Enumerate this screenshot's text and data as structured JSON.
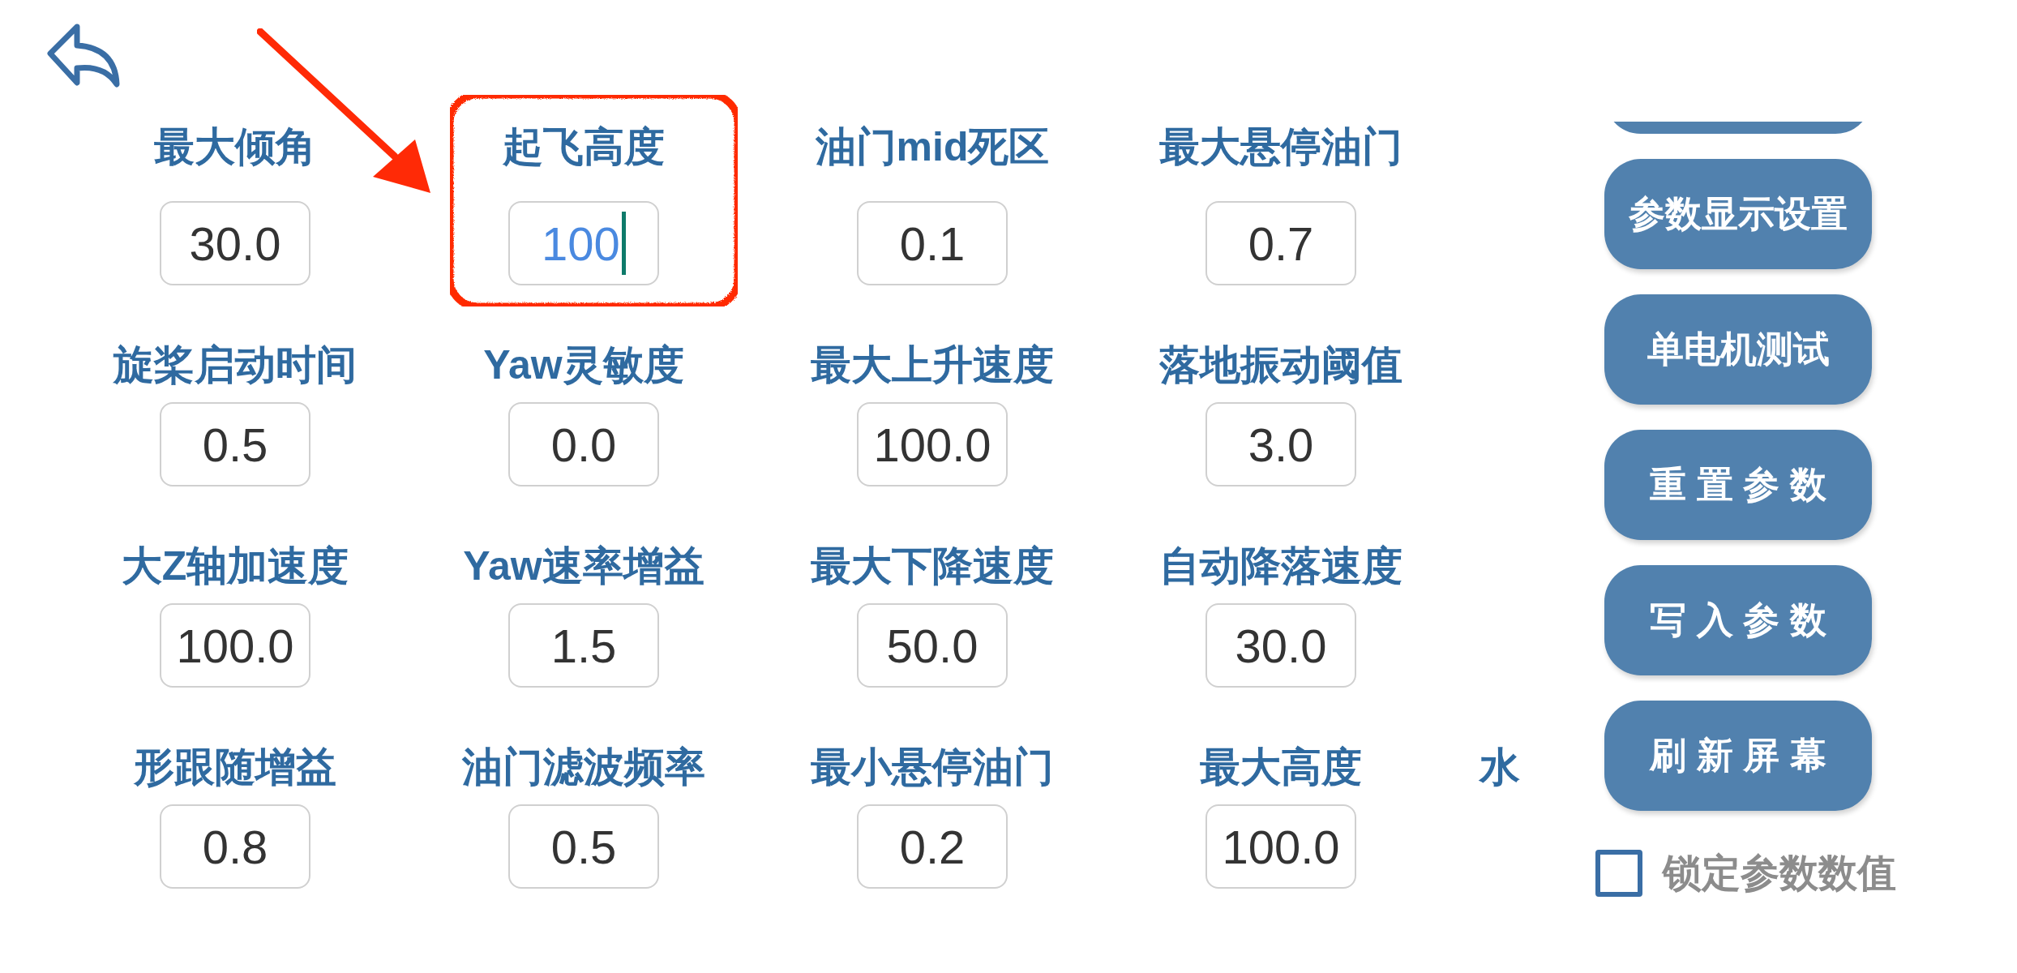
{
  "parameter_grid": {
    "rows": [
      {
        "cells": [
          {
            "label": "最大倾角",
            "value": "30.0",
            "focused": false,
            "highlighted": false
          },
          {
            "label": "起飞高度",
            "value": "100",
            "focused": true,
            "highlighted": true
          },
          {
            "label": "油门mid死区",
            "value": "0.1",
            "focused": false,
            "highlighted": false
          },
          {
            "label": "最大悬停油门",
            "value": "0.7",
            "focused": false,
            "highlighted": false
          }
        ]
      },
      {
        "cells": [
          {
            "label": "旋桨启动时间",
            "value": "0.5",
            "focused": false,
            "highlighted": false
          },
          {
            "label": "Yaw灵敏度",
            "value": "0.0",
            "focused": false,
            "highlighted": false
          },
          {
            "label": "最大上升速度",
            "value": "100.0",
            "focused": false,
            "highlighted": false
          },
          {
            "label": "落地振动阈值",
            "value": "3.0",
            "focused": false,
            "highlighted": false
          }
        ]
      },
      {
        "cells": [
          {
            "label": "大Z轴加速度",
            "value": "100.0",
            "focused": false,
            "highlighted": false
          },
          {
            "label": "Yaw速率增益",
            "value": "1.5",
            "focused": false,
            "highlighted": false
          },
          {
            "label": "最大下降速度",
            "value": "50.0",
            "focused": false,
            "highlighted": false
          },
          {
            "label": "自动降落速度",
            "value": "30.0",
            "focused": false,
            "highlighted": false
          }
        ]
      },
      {
        "cells": [
          {
            "label": "形跟随增益",
            "value": "0.8",
            "focused": false,
            "highlighted": false
          },
          {
            "label": "油门滤波频率",
            "value": "0.5",
            "focused": false,
            "highlighted": false
          },
          {
            "label": "最小悬停油门",
            "value": "0.2",
            "focused": false,
            "highlighted": false
          },
          {
            "label": "最大高度",
            "value": "100.0",
            "focused": false,
            "highlighted": false
          },
          {
            "label": "水",
            "highlighted": false
          }
        ]
      }
    ]
  },
  "side_panel": {
    "buttons": [
      {
        "kind": "clipped"
      },
      {
        "kind": "full",
        "label": "参数显示设置"
      },
      {
        "kind": "full",
        "label": "单电机测试"
      },
      {
        "kind": "full",
        "label": "重 置 参 数"
      },
      {
        "kind": "full",
        "label": "写 入 参 数"
      },
      {
        "kind": "full",
        "label": "刷 新 屏 幕"
      }
    ],
    "lock_checkbox": {
      "label": "锁定参数数值",
      "checked": false
    }
  }
}
